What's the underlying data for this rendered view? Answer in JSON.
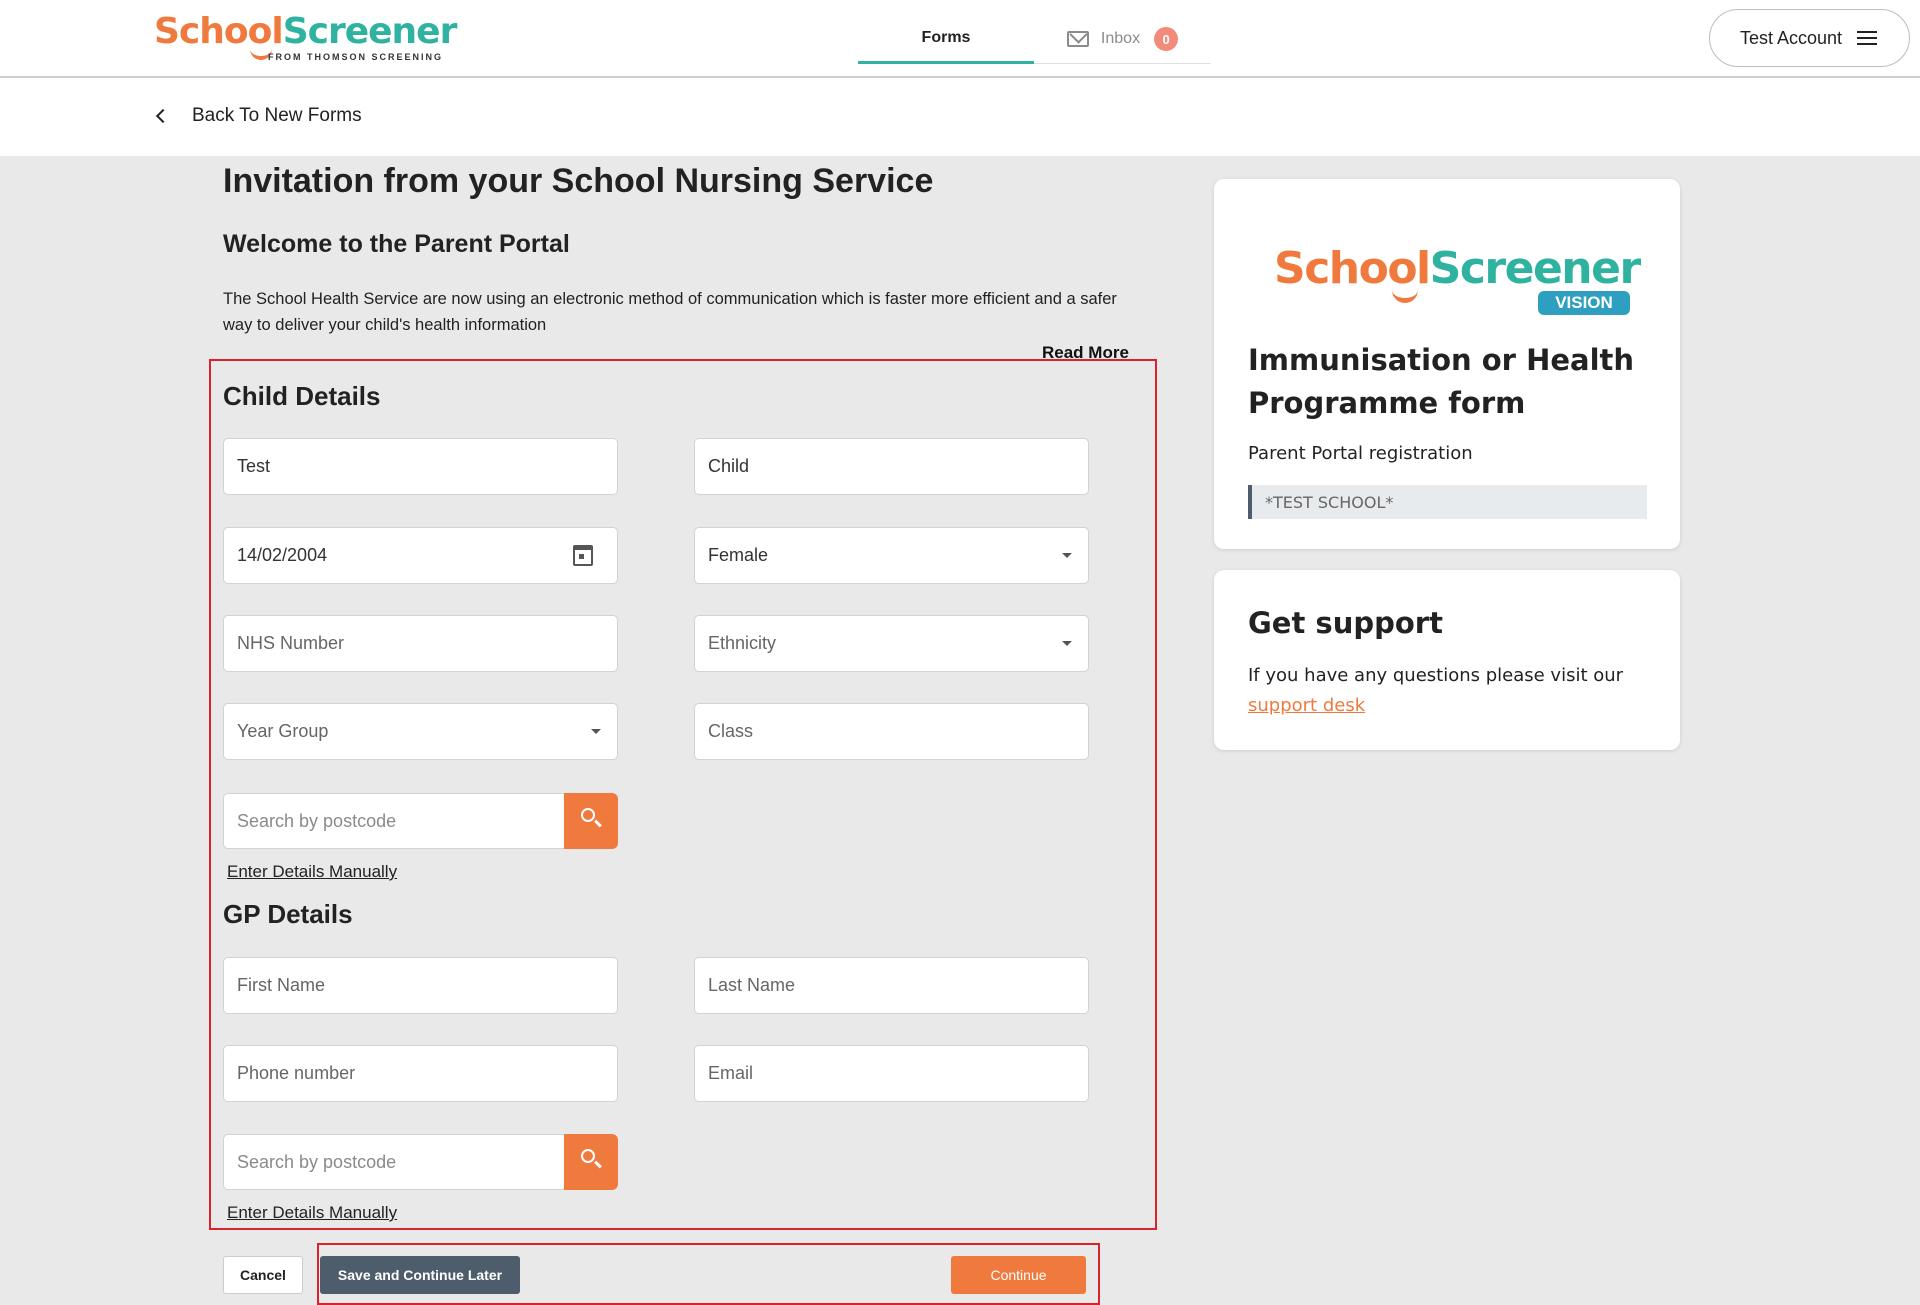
{
  "header": {
    "logo": {
      "school": "School",
      "screener": "Screener",
      "tagline": "FROM THOMSON SCREENING"
    },
    "tabs": [
      {
        "label": "Forms"
      },
      {
        "label": "Inbox",
        "badge": "0"
      }
    ],
    "account_label": "Test Account"
  },
  "back_link": "Back To New Forms",
  "main": {
    "title": "Invitation from your School Nursing Service",
    "welcome": "Welcome to the Parent Portal",
    "intro": "The School Health Service are now using an electronic method of communication which is faster more efficient and a safer way to deliver your child's health information",
    "read_more": "Read More"
  },
  "child_details": {
    "title": "Child Details",
    "first_name": "Test",
    "last_name": "Child",
    "dob": "14/02/2004",
    "gender": "Female",
    "nhs_number_placeholder": "NHS Number",
    "ethnicity_placeholder": "Ethnicity",
    "year_group_placeholder": "Year Group",
    "class_placeholder": "Class",
    "postcode_placeholder": "Search by postcode",
    "manual_link": "Enter Details Manually"
  },
  "gp_details": {
    "title": "GP Details",
    "first_name_placeholder": "First Name",
    "last_name_placeholder": "Last Name",
    "phone_placeholder": "Phone number",
    "email_placeholder": "Email",
    "postcode_placeholder": "Search by postcode",
    "manual_link": "Enter Details Manually"
  },
  "actions": {
    "cancel": "Cancel",
    "save_later": "Save and Continue Later",
    "continue": "Continue"
  },
  "form_card": {
    "logo_school": "School",
    "logo_screener": "Screener",
    "logo_badge": "VISION",
    "title_line1": "Immunisation or Health",
    "title_line2": "Programme form",
    "subtitle": "Parent Portal registration",
    "school": "*TEST SCHOOL*"
  },
  "support_card": {
    "title": "Get support",
    "text": "If you have any questions please visit our",
    "link": "support desk"
  },
  "colors": {
    "brand_orange": "#f07a3e",
    "brand_teal": "#2fb3a0",
    "highlight_red": "#d9232d",
    "save_button": "#4e5d6c"
  }
}
